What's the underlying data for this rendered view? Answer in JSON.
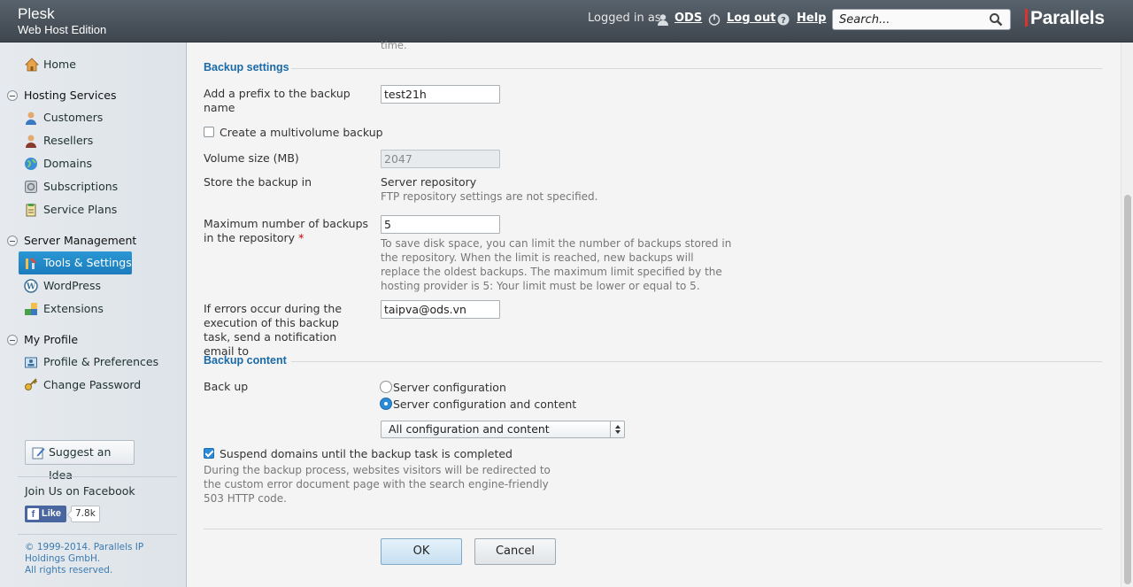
{
  "header": {
    "product": "Plesk",
    "edition": "Web Host Edition",
    "logged_in_as": "Logged in as",
    "user": "ODS",
    "logout": "Log out",
    "help": "Help",
    "search_placeholder": "Search...",
    "brand": "Parallels",
    "icons": [
      "user-icon",
      "power-icon",
      "help-icon",
      "search-icon"
    ]
  },
  "sidebar": {
    "home": "Home",
    "groups": [
      {
        "title": "Hosting Services",
        "items": [
          "Customers",
          "Resellers",
          "Domains",
          "Subscriptions",
          "Service Plans"
        ]
      },
      {
        "title": "Server Management",
        "items": [
          "Tools & Settings",
          "WordPress",
          "Extensions"
        ]
      },
      {
        "title": "My Profile",
        "items": [
          "Profile & Preferences",
          "Change Password"
        ]
      }
    ],
    "active_item": "Tools & Settings",
    "suggest": "Suggest an Idea",
    "facebook_title": "Join Us on Facebook",
    "like": "Like",
    "like_count": "7.8k",
    "copyright": "© 1999-2014. Parallels IP Holdings GmbH.",
    "rights": "All rights reserved."
  },
  "main": {
    "clipped_text": "time.",
    "backup_settings": {
      "title": "Backup settings",
      "prefix_label": "Add a prefix to the backup name",
      "prefix_value": "test21h",
      "multivolume_label": "Create a multivolume backup",
      "multivolume_checked": false,
      "volume_label": "Volume size (MB)",
      "volume_value": "2047",
      "store_label": "Store the backup in",
      "store_value": "Server repository",
      "store_hint": "FTP repository settings are not specified.",
      "max_label": "Maximum number of backups in the repository",
      "max_required": "*",
      "max_value": "5",
      "max_hint": "To save disk space, you can limit the number of backups stored in the repository. When the limit is reached, new backups will replace the oldest backups. The maximum limit specified by the hosting provider is 5: Your limit must be lower or equal to 5.",
      "email_label": "If errors occur during the execution of this backup task, send a notification email to",
      "email_value": "taipva@ods.vn"
    },
    "backup_content": {
      "title": "Backup content",
      "backup_label": "Back up",
      "options": [
        "Server configuration",
        "Server configuration and content"
      ],
      "selected_option": "Server configuration and content",
      "dropdown_value": "All configuration and content",
      "suspend_label": "Suspend domains until the backup task is completed",
      "suspend_checked": true,
      "suspend_hint": "During the backup process, websites visitors will be redirected to the custom error document page with the search engine-friendly 503 HTTP code."
    },
    "ok": "OK",
    "cancel": "Cancel"
  },
  "colors": {
    "accent": "#1c7dbd",
    "section_title": "#1a6aa8",
    "header": "#4a535c",
    "brand_red": "#e0312e"
  }
}
